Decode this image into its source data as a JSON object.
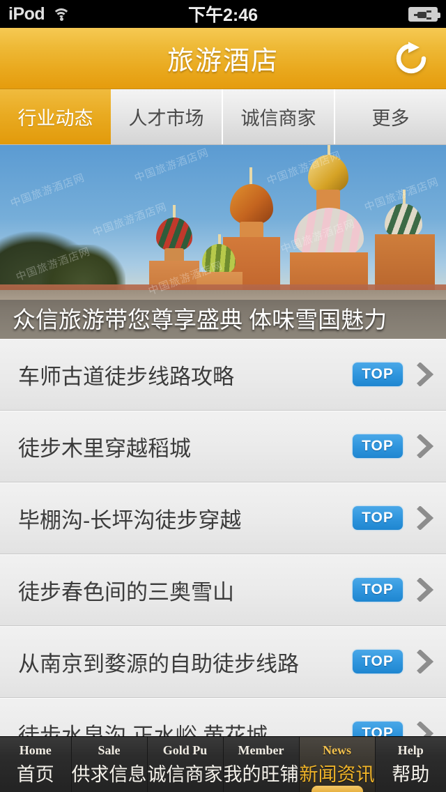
{
  "status_bar": {
    "carrier": "iPod",
    "wifi_icon": "wifi-icon",
    "time": "下午2:46",
    "battery_icon": "battery-charging-icon"
  },
  "header": {
    "title": "旅游酒店",
    "refresh_icon": "refresh-icon",
    "accent_color": "#e9a81d"
  },
  "tabs": [
    {
      "label": "行业动态",
      "active": true
    },
    {
      "label": "人才市场",
      "active": false
    },
    {
      "label": "诚信商家",
      "active": false
    },
    {
      "label": "更多",
      "active": false
    }
  ],
  "banner": {
    "caption": "众信旅游带您尊享盛典 体味雪国魅力",
    "watermark": "中国旅游酒店网",
    "alt": "圣瓦西里大教堂"
  },
  "news_list": [
    {
      "title": "车师古道徒步线路攻略",
      "badge": "TOP",
      "chevron_icon": "chevron-right-icon"
    },
    {
      "title": "徒步木里穿越稻城",
      "badge": "TOP",
      "chevron_icon": "chevron-right-icon"
    },
    {
      "title": "毕棚沟-长坪沟徒步穿越",
      "badge": "TOP",
      "chevron_icon": "chevron-right-icon"
    },
    {
      "title": "徒步春色间的三奥雪山",
      "badge": "TOP",
      "chevron_icon": "chevron-right-icon"
    },
    {
      "title": "从南京到婺源的自助徒步线路",
      "badge": "TOP",
      "chevron_icon": "chevron-right-icon"
    },
    {
      "title": "徒步水泉沟 正水峪 黄花城",
      "badge": "TOP",
      "chevron_icon": "chevron-right-icon"
    }
  ],
  "badge_color": "#2f95dd",
  "bottom_bar": [
    {
      "en": "Home",
      "cn": "首页",
      "active": false
    },
    {
      "en": "Sale",
      "cn": "供求信息",
      "active": false
    },
    {
      "en": "Gold Pu",
      "cn": "诚信商家",
      "active": false
    },
    {
      "en": "Member",
      "cn": "我的旺铺",
      "active": false
    },
    {
      "en": "News",
      "cn": "新闻资讯",
      "active": true
    },
    {
      "en": "Help",
      "cn": "帮助",
      "active": false
    }
  ]
}
